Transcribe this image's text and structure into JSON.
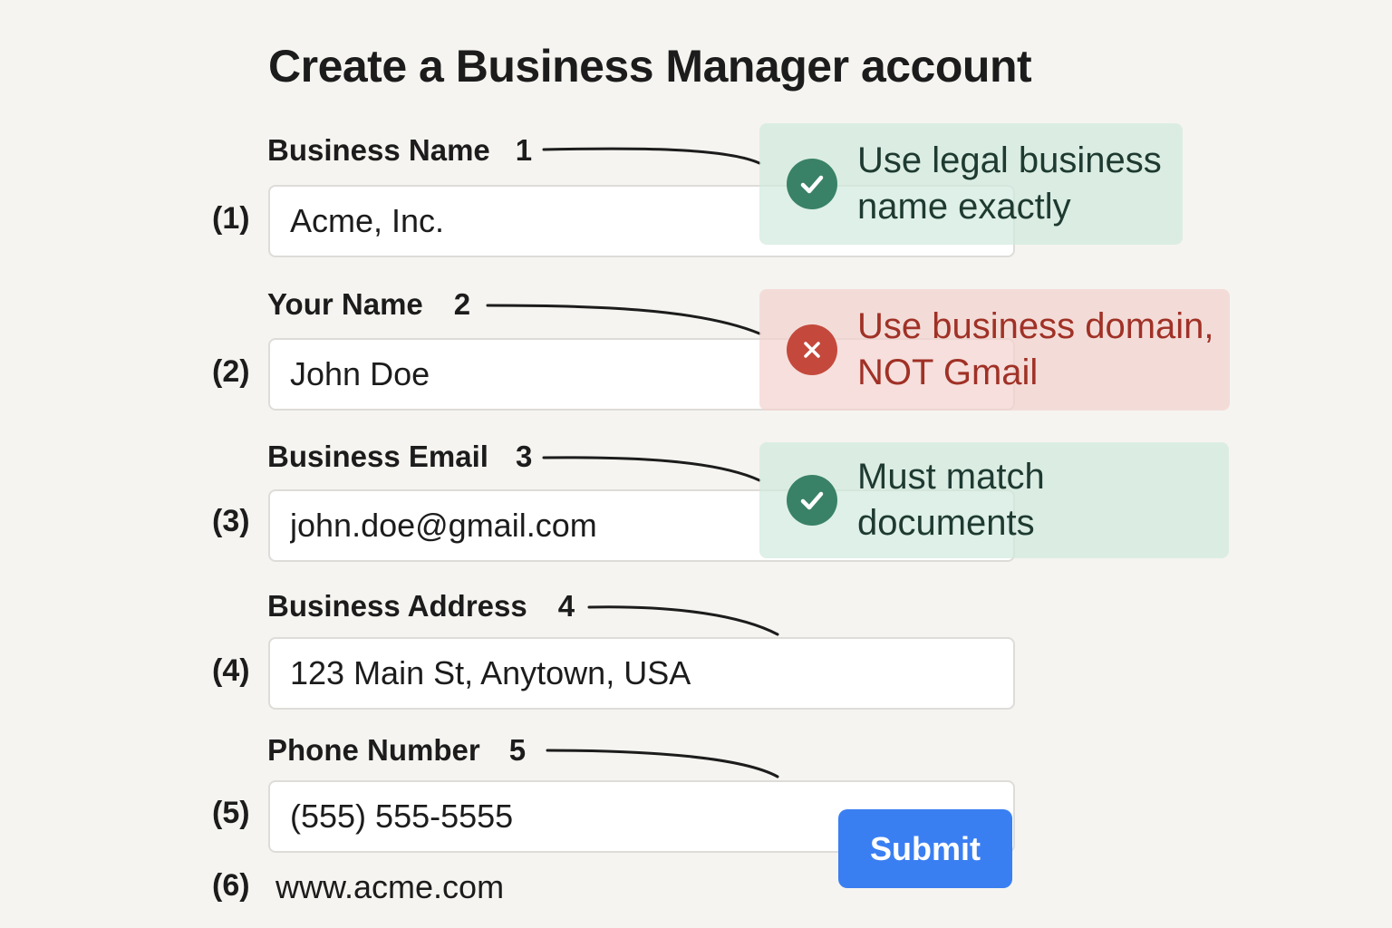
{
  "title": "Create a Business Manager account",
  "fields": [
    {
      "label": "Business Name",
      "number": "1",
      "index": "(1)",
      "value": "Acme, Inc."
    },
    {
      "label": "Your Name",
      "number": "2",
      "index": "(2)",
      "value": "John Doe"
    },
    {
      "label": "Business Email",
      "number": "3",
      "index": "(3)",
      "value": "john.doe@gmail.com"
    },
    {
      "label": "Business Address",
      "number": "4",
      "index": "(4)",
      "value": "123 Main St, Anytown, USA"
    },
    {
      "label": "Phone Number",
      "number": "5",
      "index": "(5)",
      "value": "(555) 555-5555"
    }
  ],
  "website": {
    "index": "(6)",
    "value": "www.acme.com"
  },
  "callouts": [
    {
      "status": "ok",
      "icon": "check-icon",
      "line1": "Use legal business",
      "line2": "name exactly"
    },
    {
      "status": "error",
      "icon": "x-icon",
      "line1": "Use business domain,",
      "line2": "NOT Gmail"
    },
    {
      "status": "ok",
      "icon": "check-icon",
      "line1": "Must match",
      "line2": "documents"
    }
  ],
  "submit_label": "Submit",
  "colors": {
    "background": "#f5f4f0",
    "ok_accent": "#3a8267",
    "error_accent": "#c4493c",
    "error_text": "#a03126",
    "submit": "#3a7ff2"
  }
}
